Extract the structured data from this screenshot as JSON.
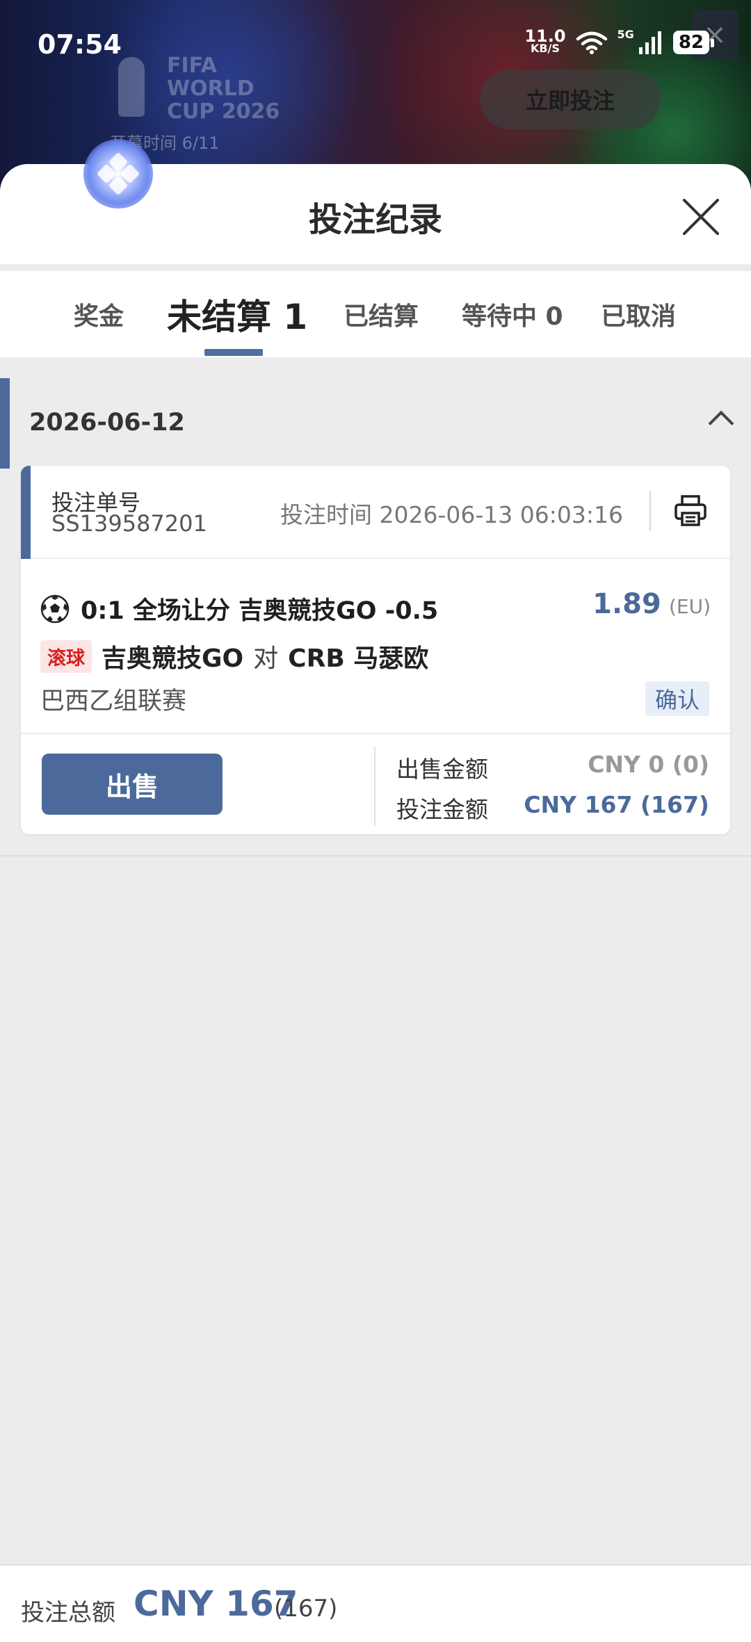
{
  "status_bar": {
    "time": "07:54",
    "net_speed": "11.0",
    "net_unit": "KB/S",
    "signal": "5G",
    "battery": "82"
  },
  "promo": {
    "logo_text": [
      "FIFA",
      "WORLD",
      "CUP 2026"
    ],
    "date_text": "开幕时间 6/11",
    "bet_now_label": "立即投注",
    "close_glyph": "×"
  },
  "sheet": {
    "title": "投注纪录"
  },
  "tabs": [
    {
      "label": "奖金"
    },
    {
      "label": "未结算 1",
      "active": true
    },
    {
      "label": "已结算"
    },
    {
      "label": "等待中 0"
    },
    {
      "label": "已取消"
    }
  ],
  "group": {
    "date": "2026-06-12"
  },
  "bet": {
    "number_label": "投注单号",
    "number": "SS139587201",
    "time_label": "投注时间",
    "time": "2026-06-13 06:03:16",
    "selection": "0:1 全场让分 吉奥競技GO -0.5",
    "odds": "1.89",
    "odds_format": "(EU)",
    "live_badge": "滚球",
    "home_team": "吉奥競技GO",
    "vs": "对",
    "away_team": "CRB 马瑟欧",
    "league": "巴西乙组联赛",
    "status": "确认",
    "sell_label": "出售",
    "sell_amount_label": "出售金额",
    "sell_amount": "CNY 0 (0)",
    "stake_label": "投注金额",
    "stake": "CNY 167 (167)"
  },
  "footer": {
    "total_label": "投注总额",
    "total": "CNY 167",
    "total_sub": "(167)"
  },
  "colors": {
    "accent": "#4b6a9b",
    "live_red": "#d52020",
    "background": "#ececec"
  }
}
